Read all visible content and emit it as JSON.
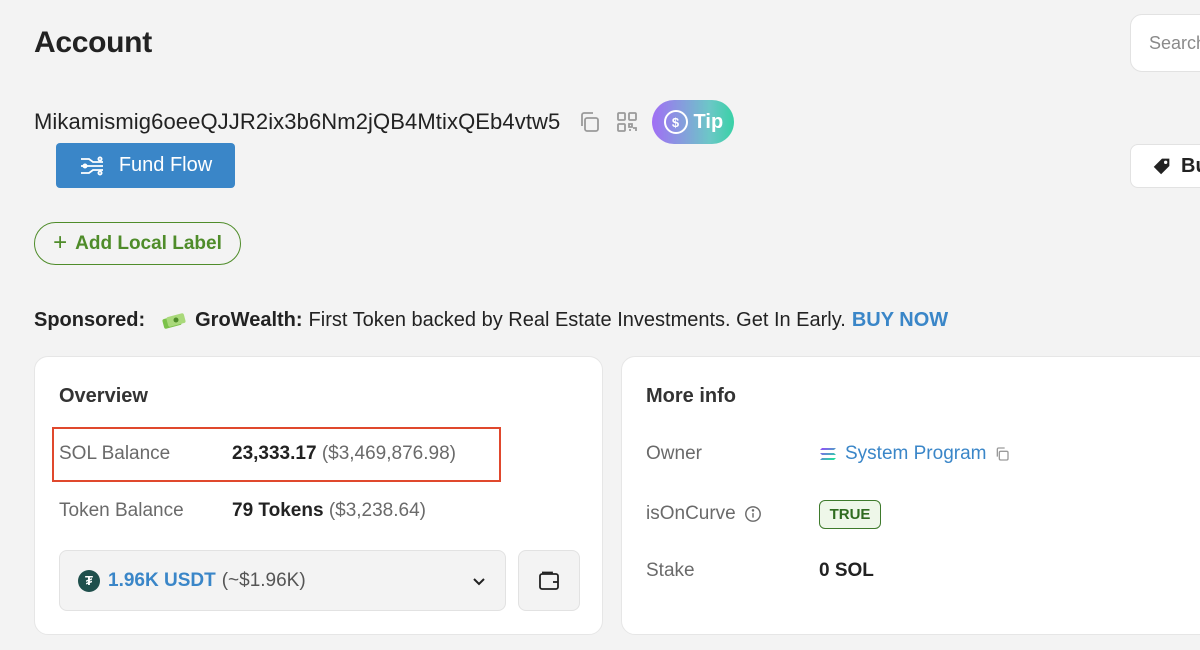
{
  "header": {
    "title": "Account",
    "search_placeholder": "Search"
  },
  "account": {
    "address": "Mikamismig6oeeQJJR2ix3b6Nm2jQB4MtixQEb4vtw5",
    "tip_label": "Tip",
    "fund_flow_label": "Fund Flow",
    "buy_label": "Bu",
    "add_label": "Add Local Label"
  },
  "sponsored": {
    "label": "Sponsored:",
    "brand": "GroWealth:",
    "text": "First Token backed by Real Estate Investments. Get In Early.",
    "cta": "BUY NOW"
  },
  "overview": {
    "title": "Overview",
    "sol_label": "SOL Balance",
    "sol_value": "23,333.17",
    "sol_usd": "($3,469,876.98)",
    "token_label": "Token Balance",
    "token_value": "79 Tokens",
    "token_usd": "($3,238.64)",
    "selected_token_amount": "1.96K USDT",
    "selected_token_usd": "(~$1.96K)"
  },
  "more_info": {
    "title": "More info",
    "owner_label": "Owner",
    "owner_value": "System Program",
    "curve_label": "isOnCurve",
    "curve_value": "TRUE",
    "stake_label": "Stake",
    "stake_value": "0 SOL"
  },
  "colors": {
    "accent_blue": "#3a86c8",
    "label_green": "#4f8c2a",
    "highlight_red": "#e0482d"
  }
}
